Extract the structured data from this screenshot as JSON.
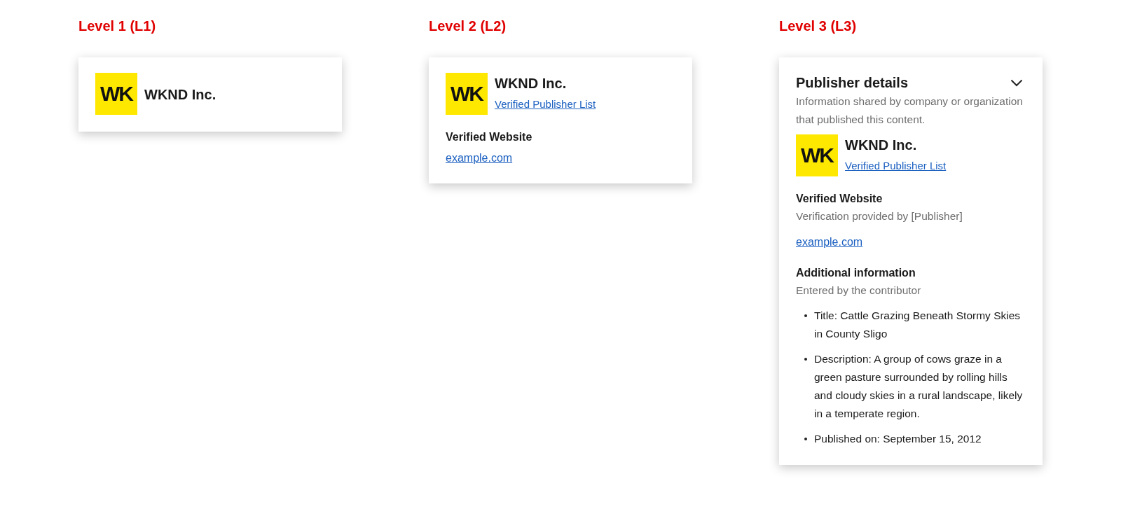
{
  "panels": [
    {
      "label": "Level 1 (L1)",
      "publisher": {
        "logo": "WK",
        "name": "WKND Inc."
      }
    },
    {
      "label": "Level 2 (L2)",
      "publisher": {
        "logo": "WK",
        "name": "WKND Inc.",
        "list_link": "Verified Publisher List"
      },
      "website": {
        "heading": "Verified Website",
        "link": "example.com"
      }
    },
    {
      "label": "Level 3 (L3)",
      "header": {
        "title": "Publisher details",
        "description": "Information shared by company or organization that published this content."
      },
      "publisher": {
        "logo": "WK",
        "name": "WKND Inc.",
        "list_link": "Verified Publisher List"
      },
      "website": {
        "heading": "Verified Website",
        "note": "Verification provided by [Publisher]",
        "link": "example.com"
      },
      "additional": {
        "heading": "Additional information",
        "note": "Entered by the contributor",
        "items": [
          "Title: Cattle Grazing Beneath Stormy Skies in County Sligo",
          "Description: A group of cows graze in a green pasture surrounded by rolling hills and cloudy skies in a rural landscape, likely in a temperate region.",
          "Published on: September 15, 2012"
        ]
      }
    }
  ]
}
